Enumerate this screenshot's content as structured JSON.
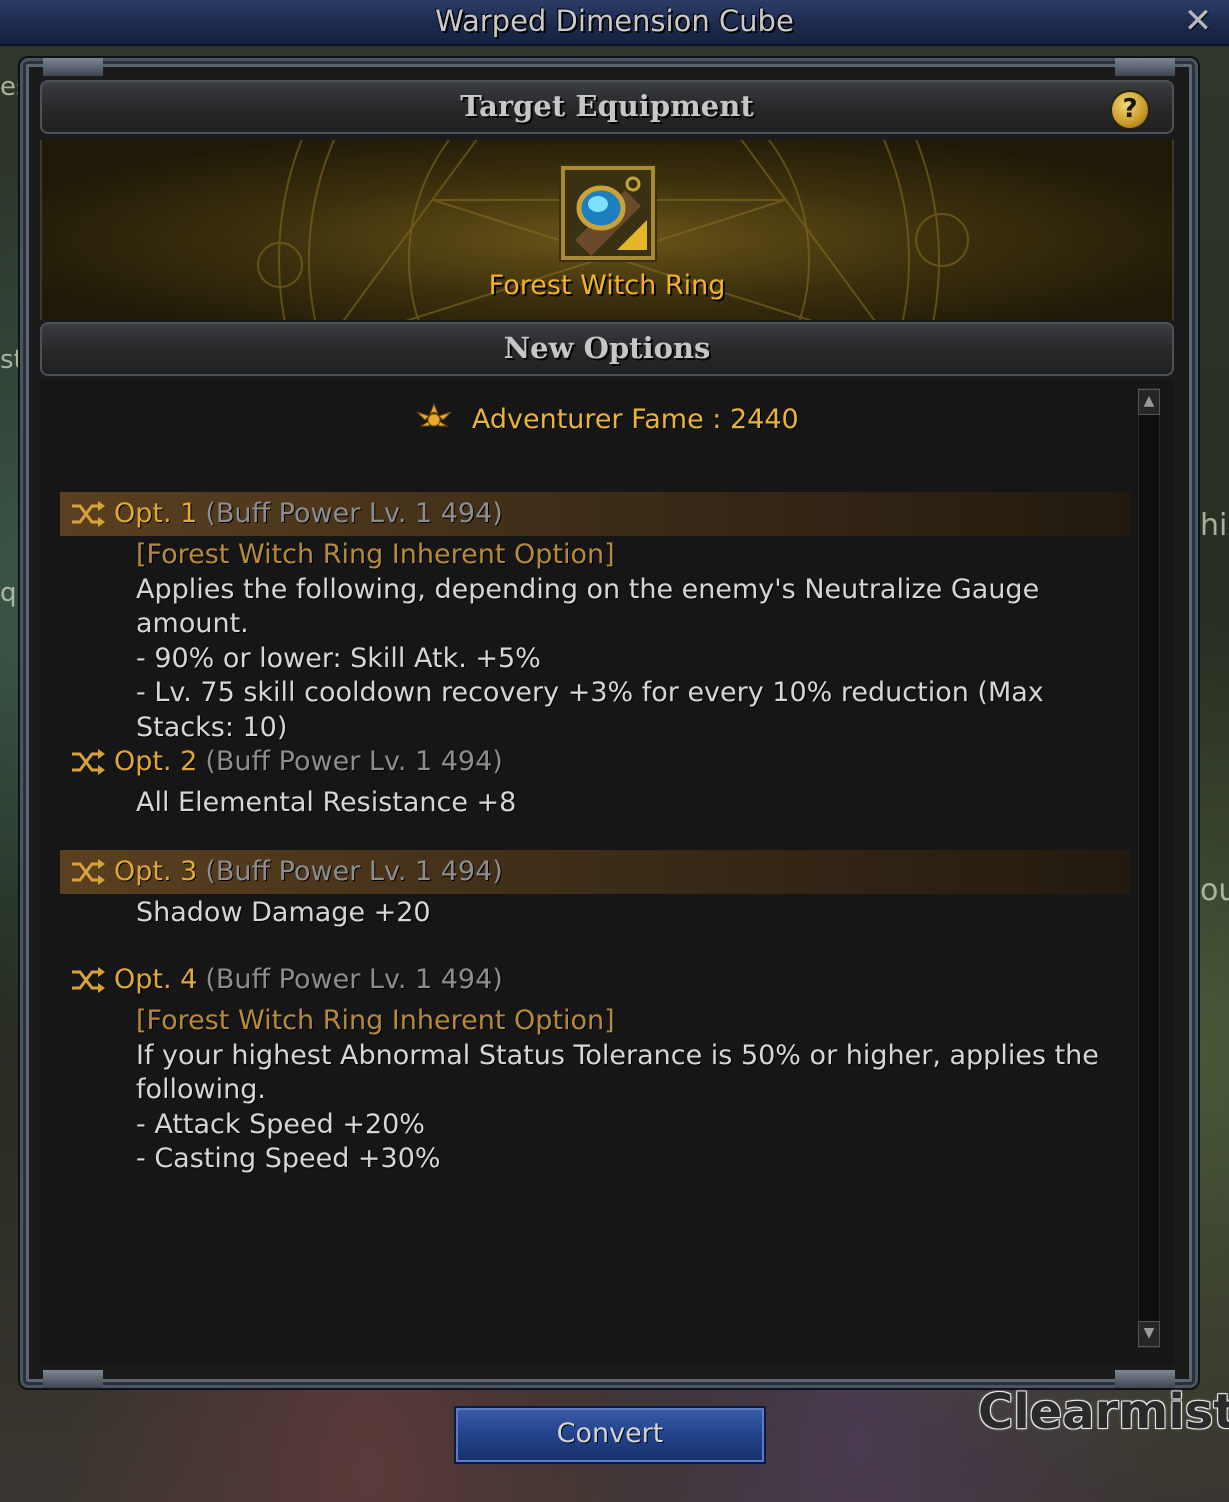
{
  "window": {
    "title": "Warped Dimension Cube",
    "close_label": "✕"
  },
  "target": {
    "header": "Target Equipment",
    "help_label": "?",
    "item_name": "Forest Witch Ring"
  },
  "new_options": {
    "header": "New Options",
    "fame_label": "Adventurer Fame : 2440",
    "options": [
      {
        "label": "Opt. 1",
        "buff": "(Buff Power Lv. 1 494)",
        "highlighted": true,
        "inherent": "[Forest Witch Ring Inherent Option]",
        "lines": [
          "Applies the following, depending on the enemy's Neutralize Gauge amount.",
          "- 90% or lower: Skill Atk. +5%",
          "- Lv. 75 skill cooldown recovery +3% for every 10% reduction (Max",
          "Stacks: 10)"
        ]
      },
      {
        "label": "Opt. 2",
        "buff": "(Buff Power Lv. 1 494)",
        "highlighted": false,
        "lines": [
          "All Elemental Resistance +8"
        ]
      },
      {
        "label": "Opt. 3",
        "buff": "(Buff Power Lv. 1 494)",
        "highlighted": true,
        "lines": [
          "Shadow Damage +20"
        ]
      },
      {
        "label": "Opt. 4",
        "buff": "(Buff Power Lv. 1 494)",
        "highlighted": false,
        "inherent": "[Forest Witch Ring Inherent Option]",
        "lines": [
          "If your highest Abnormal Status Tolerance is 50% or higher, applies the",
          "following.",
          "- Attack Speed +20%",
          "- Casting Speed +30%"
        ]
      }
    ]
  },
  "convert_label": "Convert",
  "background": {
    "player_name": "Clearmist",
    "left_edge_texts": [
      "es",
      "st",
      "qu"
    ],
    "right_edge_texts": [
      "hi",
      "ou"
    ]
  },
  "icons": {
    "close": "close-icon",
    "help": "question-icon",
    "fame": "fame-crest-icon",
    "option": "shuffle-icon"
  },
  "colors": {
    "accent_gold": "#e0a83a",
    "item_name": "#f2b32a",
    "inherent": "#b58a3c",
    "button_blue": "#22428a"
  }
}
